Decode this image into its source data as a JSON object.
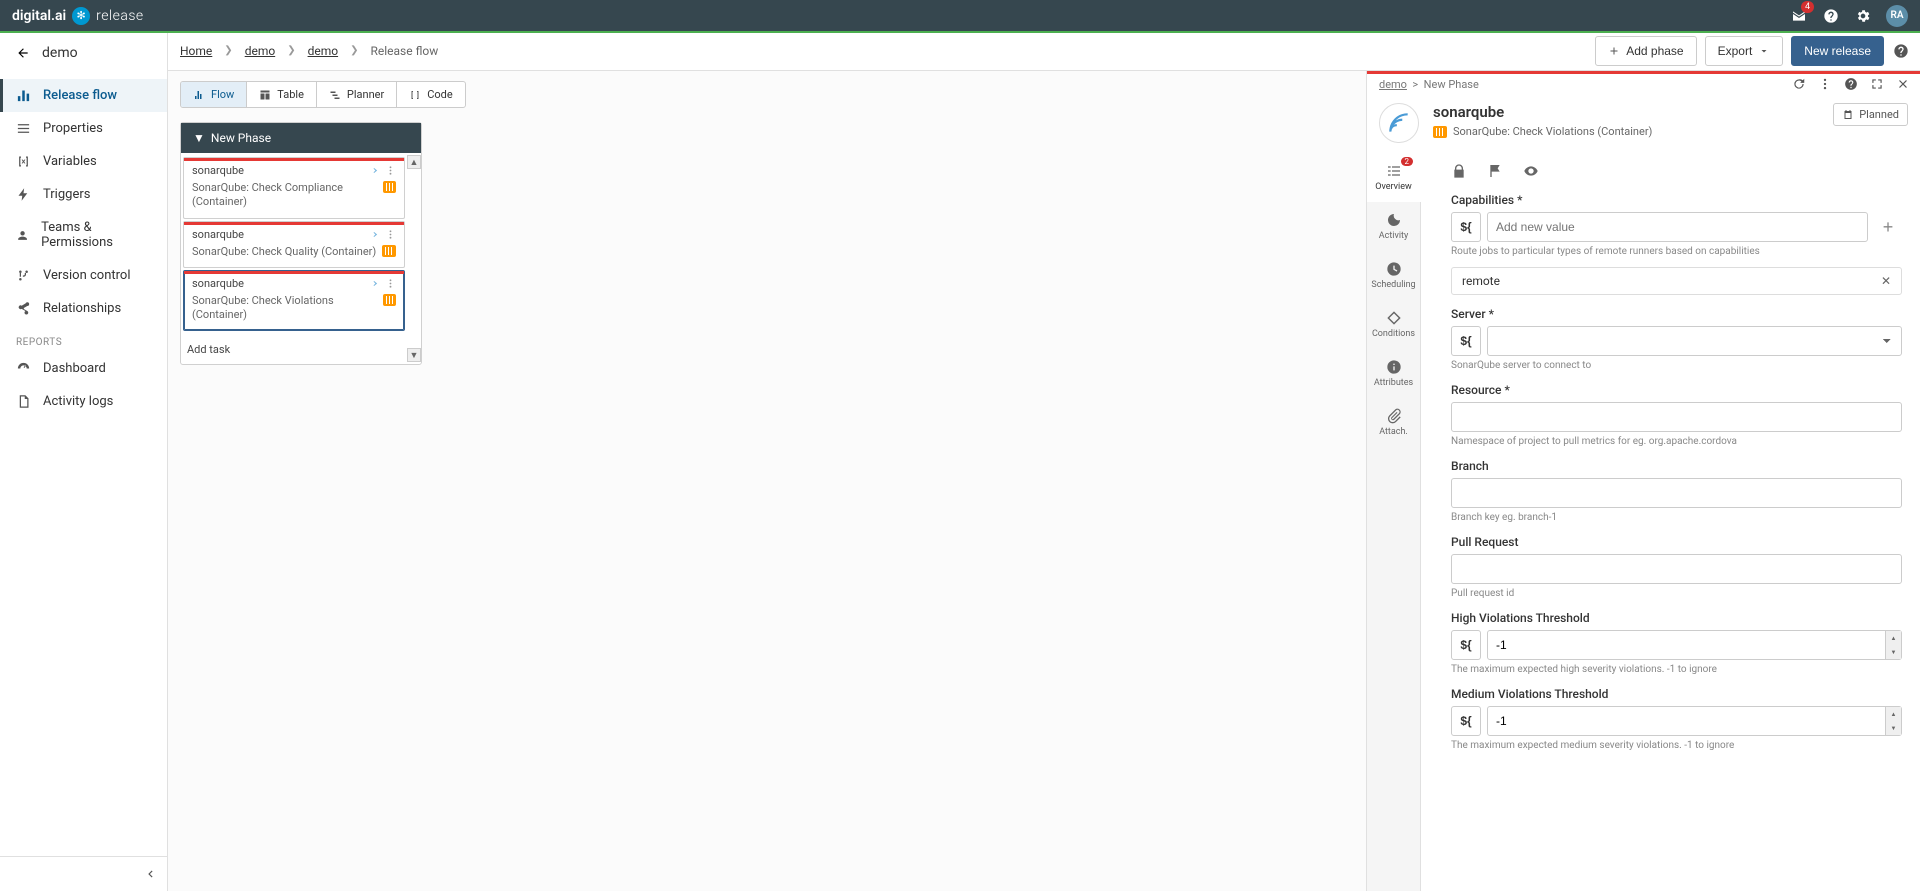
{
  "topbar": {
    "brand_main": "digital.ai",
    "brand_sub": "release",
    "notifications_count": "4",
    "avatar_initials": "RA"
  },
  "sidebar": {
    "title": "demo",
    "items": [
      {
        "label": "Release flow",
        "active": true
      },
      {
        "label": "Properties"
      },
      {
        "label": "Variables"
      },
      {
        "label": "Triggers"
      },
      {
        "label": "Teams & Permissions"
      },
      {
        "label": "Version control"
      },
      {
        "label": "Relationships"
      }
    ],
    "section": "REPORTS",
    "report_items": [
      {
        "label": "Dashboard"
      },
      {
        "label": "Activity logs"
      }
    ]
  },
  "breadcrumb": {
    "items": [
      "Home",
      "demo",
      "demo"
    ],
    "current": "Release flow"
  },
  "header_buttons": {
    "add_phase": "Add phase",
    "export": "Export",
    "new_release": "New release"
  },
  "view_tabs": [
    {
      "label": "Flow"
    },
    {
      "label": "Table"
    },
    {
      "label": "Planner"
    },
    {
      "label": "Code"
    }
  ],
  "phase": {
    "title": "New Phase",
    "tasks": [
      {
        "name": "sonarqube",
        "desc": "SonarQube: Check Compliance (Container)"
      },
      {
        "name": "sonarqube",
        "desc": "SonarQube: Check Quality (Container)"
      },
      {
        "name": "sonarqube",
        "desc": "SonarQube: Check Violations (Container)",
        "selected": true
      }
    ],
    "add_task": "Add task"
  },
  "detail": {
    "breadcrumb_root": "demo",
    "breadcrumb_phase": "New Phase",
    "title": "sonarqube",
    "subtitle": "SonarQube: Check Violations (Container)",
    "status": "Planned",
    "tabs": [
      {
        "label": "Overview",
        "badge": "2",
        "active": true
      },
      {
        "label": "Activity"
      },
      {
        "label": "Scheduling"
      },
      {
        "label": "Conditions"
      },
      {
        "label": "Attributes"
      },
      {
        "label": "Attach."
      }
    ],
    "form": {
      "capabilities_label": "Capabilities *",
      "capabilities_placeholder": "Add new value",
      "capabilities_help": "Route jobs to particular types of remote runners based on capabilities",
      "capabilities_value": "remote",
      "server_label": "Server *",
      "server_help": "SonarQube server to connect to",
      "resource_label": "Resource *",
      "resource_help": "Namespace of project to pull metrics for eg. org.apache.cordova",
      "branch_label": "Branch",
      "branch_help": "Branch key eg. branch-1",
      "pr_label": "Pull Request",
      "pr_help": "Pull request id",
      "high_label": "High Violations Threshold",
      "high_value": "-1",
      "high_help": "The maximum expected high severity violations. -1 to ignore",
      "med_label": "Medium Violations Threshold",
      "med_value": "-1",
      "med_help": "The maximum expected medium severity violations. -1 to ignore"
    }
  }
}
